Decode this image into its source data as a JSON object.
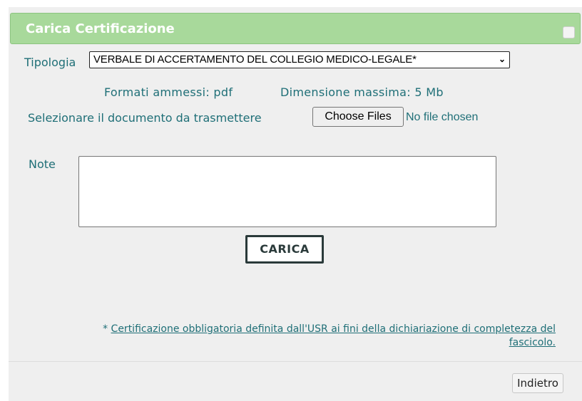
{
  "dialog": {
    "title": "Carica Certificazione",
    "close_icon": "close-icon"
  },
  "form": {
    "type_label": "Tipologia",
    "type_selected": "VERBALE DI ACCERTAMENTO DEL COLLEGIO MEDICO-LEGALE*",
    "type_chevron": "⌄",
    "formats_text": "Formati ammessi: pdf",
    "maxsize_text": "Dimensione massima: 5 Mb",
    "document_label": "Selezionare il documento da trasmettere",
    "choose_files_label": "Choose Files",
    "no_file_text": "No file chosen",
    "note_label": "Note",
    "note_value": "",
    "upload_button": "CARICA"
  },
  "footnote": {
    "asterisk": "*",
    "link_text": "Certificazione obbligatoria definita dall'USR ai fini della dichiariazione di completezza del fascicolo."
  },
  "footer": {
    "back_button": "Indietro"
  },
  "colors": {
    "title_bar": "#a8d99b",
    "label_text": "#1f6f77",
    "panel_bg": "#efefef"
  }
}
